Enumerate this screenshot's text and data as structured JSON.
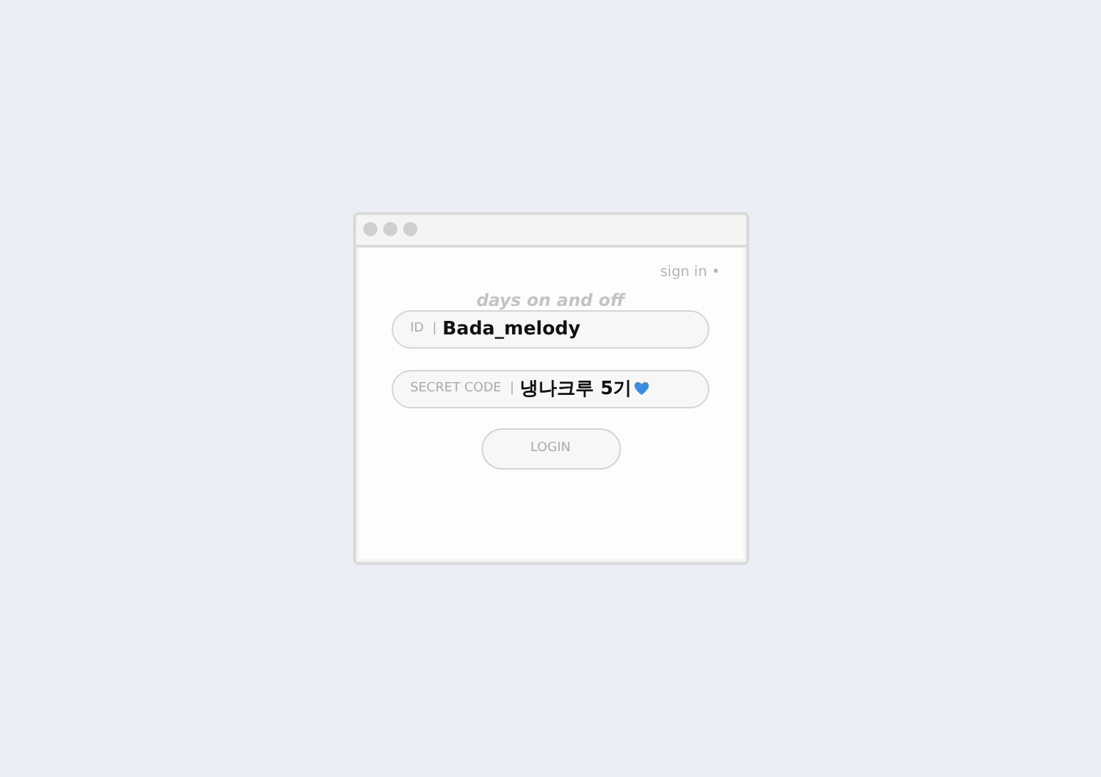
{
  "window": {
    "controls": [
      {
        "kind": "dot"
      },
      {
        "kind": "dot"
      },
      {
        "kind": "dot"
      }
    ]
  },
  "sign_in": {
    "label": "sign in",
    "marker": "•"
  },
  "title": "days on and off",
  "fields": [
    {
      "label": "ID",
      "separator": "|",
      "value": "Bada_melody",
      "heart": false
    },
    {
      "label": "SECRET CODE",
      "separator": "|",
      "value": "냉나크루 5기",
      "heart": true
    }
  ],
  "button": "LOGIN"
}
